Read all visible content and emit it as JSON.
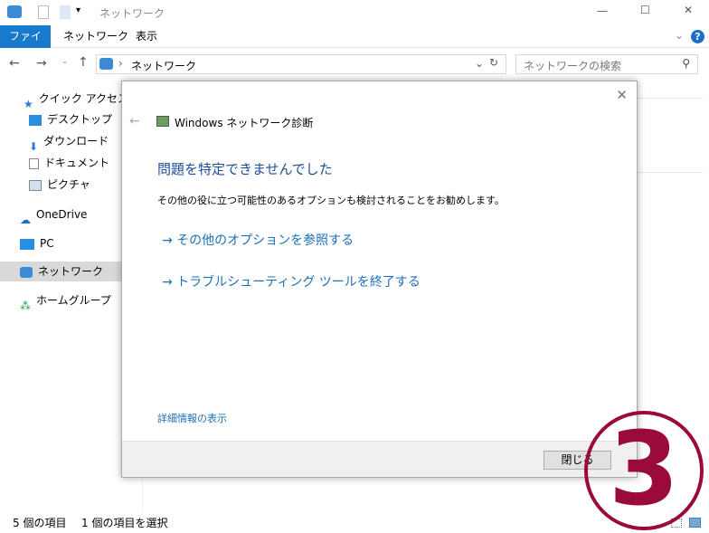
{
  "window": {
    "title": "ネットワーク",
    "minimize": "—",
    "maximize": "☐",
    "close": "✕"
  },
  "ribbon": {
    "tabs": [
      "ファイル",
      "ネットワーク",
      "表示"
    ],
    "help": "?"
  },
  "address": {
    "path": "ネットワーク",
    "search_placeholder": "ネットワークの検索"
  },
  "sidebar": {
    "items": [
      {
        "label": "クイック アクセス",
        "icon": "star-icon"
      },
      {
        "label": "デスクトップ",
        "icon": "desktop-icon"
      },
      {
        "label": "ダウンロード",
        "icon": "download-icon"
      },
      {
        "label": "ドキュメント",
        "icon": "document-icon"
      },
      {
        "label": "ピクチャ",
        "icon": "picture-icon"
      },
      {
        "label": "OneDrive",
        "icon": "cloud-icon"
      },
      {
        "label": "PC",
        "icon": "pc-icon"
      },
      {
        "label": "ネットワーク",
        "icon": "network-icon"
      },
      {
        "label": "ホームグループ",
        "icon": "homegroup-icon"
      }
    ]
  },
  "dialog": {
    "title": "Windows ネットワーク診断",
    "heading": "問題を特定できませんでした",
    "description": "その他の役に立つ可能性のあるオプションも検討されることをお勧めします。",
    "options": [
      "その他のオプションを参照する",
      "トラブルシューティング ツールを終了する"
    ],
    "details_link": "詳細情報の表示",
    "close_button": "閉じる"
  },
  "status": {
    "item_count": "5 個の項目",
    "selected": "1 個の項目を選択"
  },
  "overlay": {
    "step_number": "3",
    "color": "#9b0a3c"
  }
}
